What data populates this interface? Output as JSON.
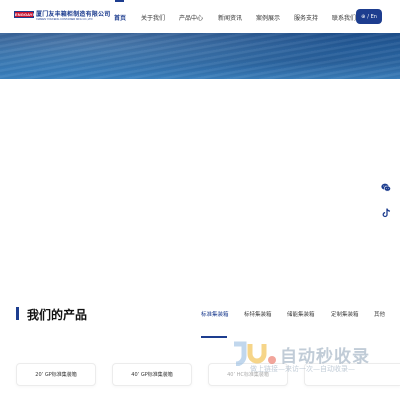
{
  "header": {
    "logo": {
      "badge": "ENGGAYE",
      "name_cn": "厦门友丰箱柜制造有限公司",
      "name_en": "XIAMEN YOUFENG CONTAINER MFG CO.,LTD"
    },
    "nav": [
      {
        "label": "首页",
        "active": true
      },
      {
        "label": "关于我们",
        "active": false
      },
      {
        "label": "产品中心",
        "active": false
      },
      {
        "label": "新闻资讯",
        "active": false
      },
      {
        "label": "案例展示",
        "active": false
      },
      {
        "label": "服务支持",
        "active": false
      },
      {
        "label": "联系我们",
        "active": false
      }
    ],
    "lang_button": {
      "label": "/ En",
      "icon": "globe-icon"
    }
  },
  "side_icons": [
    "wechat-icon",
    "tiktok-icon"
  ],
  "products": {
    "title": "我们的产品",
    "tabs": [
      {
        "label": "标准集装箱",
        "active": true
      },
      {
        "label": "标特集装箱",
        "active": false
      },
      {
        "label": "储能集装箱",
        "active": false
      },
      {
        "label": "定制集装箱",
        "active": false
      },
      {
        "label": "其他",
        "active": false
      }
    ],
    "cards": [
      {
        "label": "20’ GP标准集装箱"
      },
      {
        "label": "40’ GP标准集装箱"
      },
      {
        "label": "40’ HC标准集装箱"
      },
      {
        "label": ""
      }
    ]
  },
  "watermark": {
    "main": "自动秒收录",
    "sub": "做上链接—来访一次—自动收录—"
  },
  "colors": {
    "brand": "#1d3d8f",
    "logo_red": "#c8102e",
    "banner_top": "#1e4e8a",
    "banner_bottom": "#3c82bf"
  }
}
